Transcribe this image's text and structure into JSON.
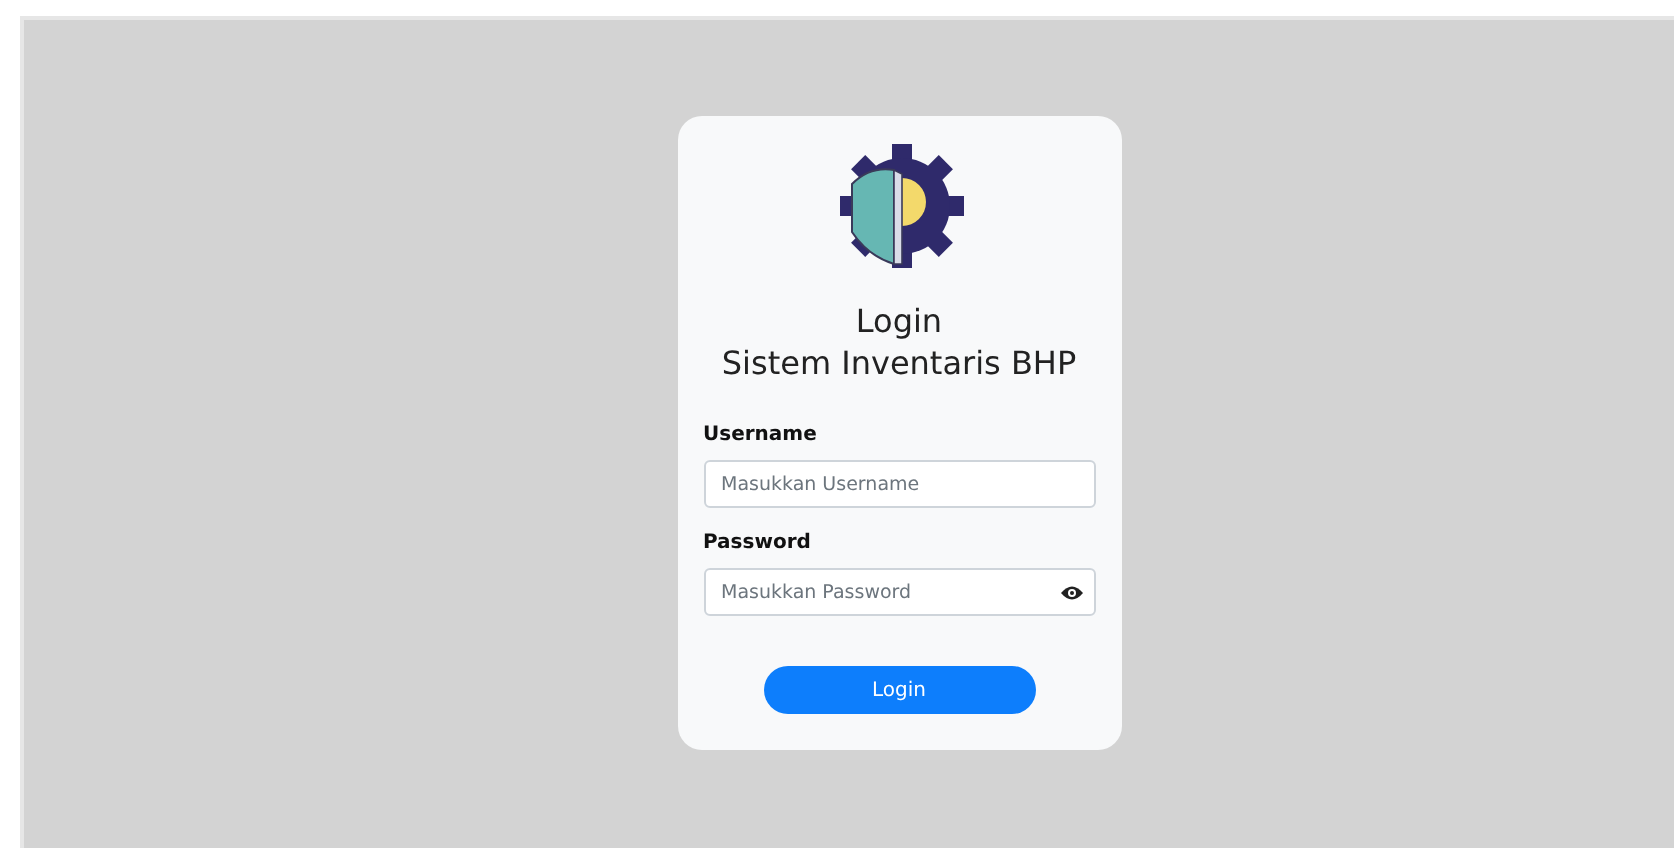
{
  "title": [
    "Login",
    "Sistem Inventaris BHP"
  ],
  "fields": [
    {
      "label": "Username",
      "placeholder": "Masukkan Username",
      "kind": "text"
    },
    {
      "label": "Password",
      "placeholder": "Masukkan Password",
      "kind": "password"
    }
  ],
  "submit": "Login"
}
